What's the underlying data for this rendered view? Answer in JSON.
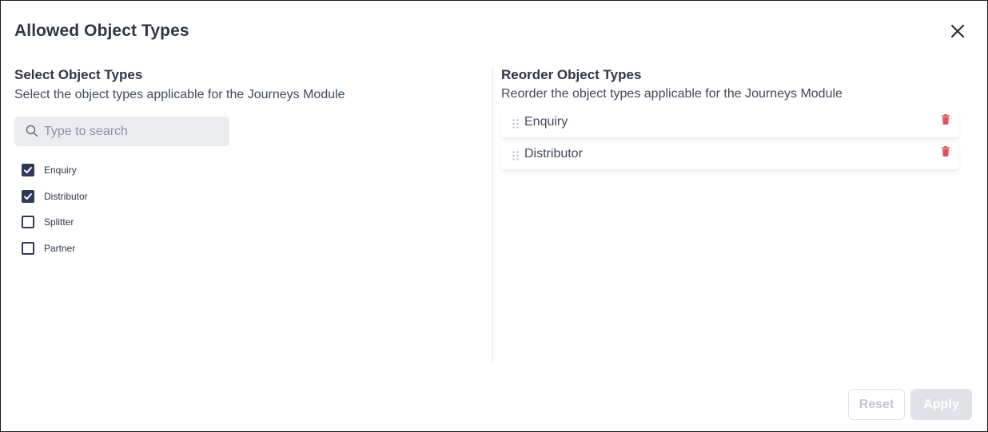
{
  "modal": {
    "title": "Allowed Object Types",
    "close_icon": "close-icon"
  },
  "select_section": {
    "title": "Select Object Types",
    "subtitle": "Select the object types applicable for the Journeys Module",
    "search": {
      "placeholder": "Type to search",
      "value": ""
    },
    "options": [
      {
        "label": "Enquiry",
        "checked": true
      },
      {
        "label": "Distributor",
        "checked": true
      },
      {
        "label": "Splitter",
        "checked": false
      },
      {
        "label": "Partner",
        "checked": false
      }
    ]
  },
  "reorder_section": {
    "title": "Reorder Object Types",
    "subtitle": "Reorder the object types applicable for the Journeys Module",
    "items": [
      {
        "label": "Enquiry"
      },
      {
        "label": "Distributor"
      }
    ]
  },
  "footer": {
    "reset_label": "Reset",
    "apply_label": "Apply"
  },
  "colors": {
    "checkbox_checked": "#2e3a59",
    "delete_icon": "#e05252",
    "search_bg": "#ebecef",
    "disabled_button_bg": "#dfe2e6"
  }
}
